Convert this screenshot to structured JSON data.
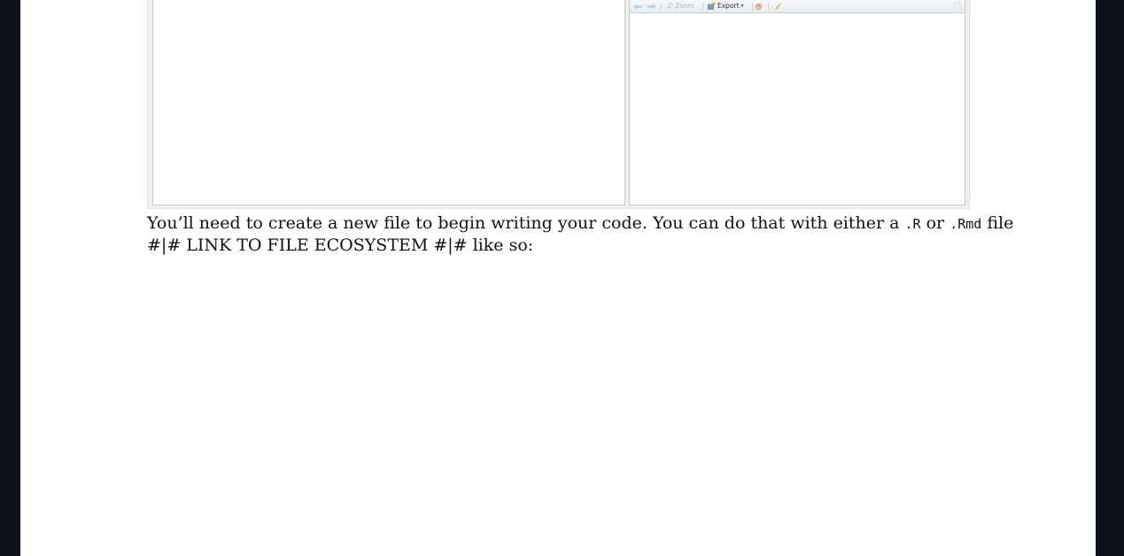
{
  "figure": {
    "plot_toolbar": {
      "zoom_label": "Zoom",
      "export_label": "Export",
      "caret": "▾"
    }
  },
  "paragraph": {
    "line1_part1": "You’ll need to create a new file to begin writing your code. You can do that with either a",
    "code_r": ".R",
    "or_word": "or",
    "code_rmd": ".Rmd",
    "line1_end": "file",
    "line2": "#|# LINK TO FILE ECOSYSTEM #|# like so:"
  }
}
